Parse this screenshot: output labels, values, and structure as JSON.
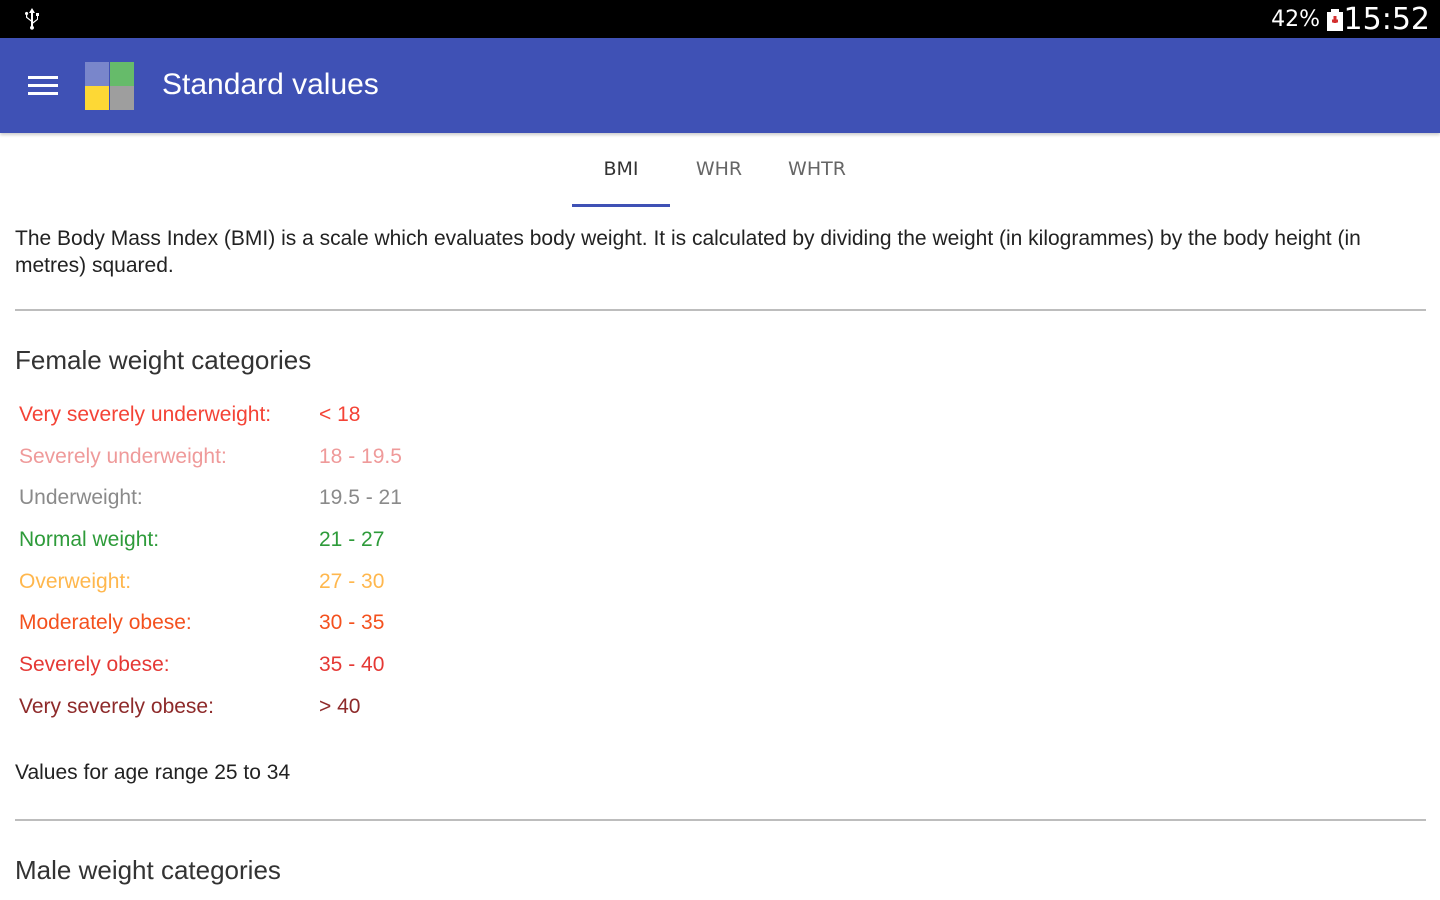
{
  "status_bar": {
    "icons": [
      "usb-icon",
      "battery-alert-icon"
    ],
    "battery": "42%",
    "time": "15:52"
  },
  "app_bar": {
    "title": "Standard values",
    "icons": [
      "menu-icon",
      "app-logo-icon"
    ]
  },
  "tabs": [
    {
      "label": "BMI",
      "active": true
    },
    {
      "label": "WHR",
      "active": false
    },
    {
      "label": "WHTR",
      "active": false
    }
  ],
  "intro": "The Body Mass Index (BMI) is a scale which evaluates body weight. It is calculated by dividing the weight (in kilogrammes) by the body height (in metres) squared.",
  "female_section": {
    "title": "Female weight categories",
    "categories": [
      {
        "label": "Very severely underweight:",
        "value": "< 18",
        "color": "#f44336"
      },
      {
        "label": "Severely underweight:",
        "value": "18 - 19.5",
        "color": "#ef9a9a"
      },
      {
        "label": "Underweight:",
        "value": "19.5 - 21",
        "color": "#8a8a8a"
      },
      {
        "label": "Normal weight:",
        "value": "21 - 27",
        "color": "#2e9b3a"
      },
      {
        "label": "Overweight:",
        "value": "27 - 30",
        "color": "#ffb74d"
      },
      {
        "label": "Moderately obese:",
        "value": "30 - 35",
        "color": "#f4511e"
      },
      {
        "label": "Severely obese:",
        "value": "35 - 40",
        "color": "#e53935"
      },
      {
        "label": "Very severely obese:",
        "value": "> 40",
        "color": "#8e2a2a"
      }
    ],
    "age_note": "Values for age range 25 to 34"
  },
  "male_section": {
    "title": "Male weight categories"
  }
}
